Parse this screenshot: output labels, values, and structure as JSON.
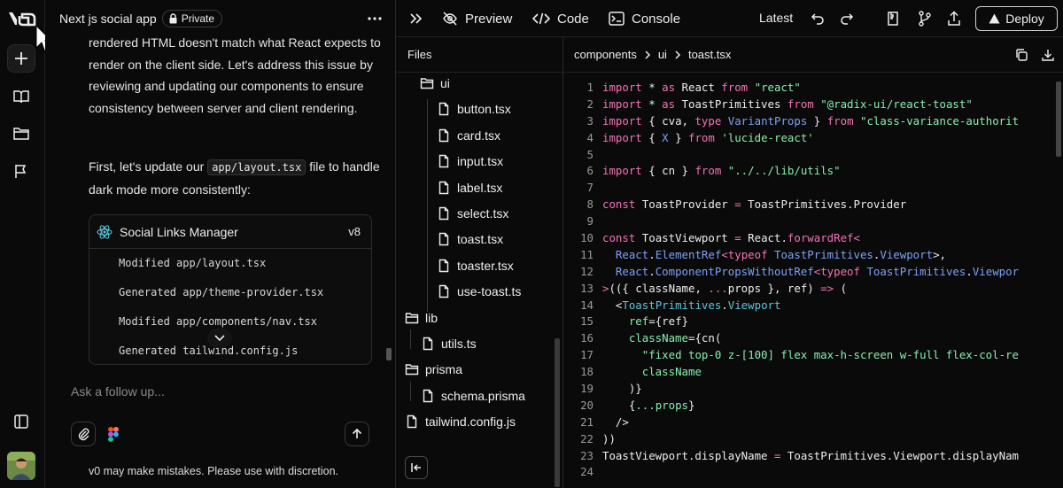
{
  "chat": {
    "title": "Next js social app",
    "badge": "Private",
    "message_part1": "rendered HTML doesn't match what React expects to render on the client side. Let's address this issue by reviewing and updating our components to ensure consistency between server and client rendering.",
    "message_part2_before": "First, let's update our ",
    "message_part2_code": "app/layout.tsx",
    "message_part2_after": " file to handle dark mode more consistently:",
    "card": {
      "title": "Social Links Manager",
      "version": "v8",
      "lines": [
        "Modified app/layout.tsx",
        "Generated app/theme-provider.tsx",
        "Modified app/components/nav.tsx",
        "Generated tailwind.config.js"
      ]
    },
    "input_placeholder": "Ask a follow up...",
    "disclaimer": "v0 may make mistakes. Please use with discretion."
  },
  "topbar": {
    "preview": "Preview",
    "code": "Code",
    "console": "Console",
    "version_label": "Latest",
    "deploy": "Deploy"
  },
  "files": {
    "header": "Files",
    "tree": [
      {
        "label": "ui",
        "kind": "folder"
      },
      {
        "label": "button.tsx",
        "kind": "file"
      },
      {
        "label": "card.tsx",
        "kind": "file"
      },
      {
        "label": "input.tsx",
        "kind": "file"
      },
      {
        "label": "label.tsx",
        "kind": "file"
      },
      {
        "label": "select.tsx",
        "kind": "file"
      },
      {
        "label": "toast.tsx",
        "kind": "file"
      },
      {
        "label": "toaster.tsx",
        "kind": "file"
      },
      {
        "label": "use-toast.ts",
        "kind": "file"
      },
      {
        "label": "lib",
        "kind": "folder"
      },
      {
        "label": "utils.ts",
        "kind": "file"
      },
      {
        "label": "prisma",
        "kind": "folder"
      },
      {
        "label": "schema.prisma",
        "kind": "file"
      },
      {
        "label": "tailwind.config.js",
        "kind": "file"
      }
    ]
  },
  "editor": {
    "breadcrumb": [
      "components",
      "ui",
      "toast.tsx"
    ],
    "lines": [
      [
        [
          "kw",
          "import"
        ],
        [
          "pl",
          " * "
        ],
        [
          "kw",
          "as"
        ],
        [
          "pl",
          " React "
        ],
        [
          "kw",
          "from"
        ],
        [
          "pl",
          " "
        ],
        [
          "str",
          "\"react\""
        ]
      ],
      [
        [
          "kw",
          "import"
        ],
        [
          "pl",
          " * "
        ],
        [
          "kw",
          "as"
        ],
        [
          "pl",
          " ToastPrimitives "
        ],
        [
          "kw",
          "from"
        ],
        [
          "pl",
          " "
        ],
        [
          "str",
          "\"@radix-ui/react-toast\""
        ]
      ],
      [
        [
          "kw",
          "import"
        ],
        [
          "pl",
          " { cva, "
        ],
        [
          "kw",
          "type"
        ],
        [
          "pl",
          " "
        ],
        [
          "ty",
          "VariantProps"
        ],
        [
          "pl",
          " } "
        ],
        [
          "kw",
          "from"
        ],
        [
          "pl",
          " "
        ],
        [
          "str",
          "\"class-variance-authorit"
        ]
      ],
      [
        [
          "kw",
          "import"
        ],
        [
          "pl",
          " { "
        ],
        [
          "ty",
          "X"
        ],
        [
          "pl",
          " } "
        ],
        [
          "kw",
          "from"
        ],
        [
          "pl",
          " "
        ],
        [
          "str",
          "'lucide-react'"
        ]
      ],
      [],
      [
        [
          "kw",
          "import"
        ],
        [
          "pl",
          " { cn } "
        ],
        [
          "kw",
          "from"
        ],
        [
          "pl",
          " "
        ],
        [
          "str",
          "\"../../lib/utils\""
        ]
      ],
      [],
      [
        [
          "kw",
          "const"
        ],
        [
          "pl",
          " ToastProvider "
        ],
        [
          "kw",
          "="
        ],
        [
          "pl",
          " ToastPrimitives.Provider"
        ]
      ],
      [],
      [
        [
          "kw",
          "const"
        ],
        [
          "pl",
          " ToastViewport "
        ],
        [
          "kw",
          "="
        ],
        [
          "pl",
          " React."
        ],
        [
          "kw",
          "forwardRef"
        ],
        [
          "kw",
          "<"
        ]
      ],
      [
        [
          "pl",
          "  "
        ],
        [
          "ty",
          "React"
        ],
        [
          "pl",
          "."
        ],
        [
          "ty",
          "ElementRef"
        ],
        [
          "kw",
          "<typeof"
        ],
        [
          "pl",
          " "
        ],
        [
          "ty",
          "ToastPrimitives"
        ],
        [
          "pl",
          "."
        ],
        [
          "ty",
          "Viewport"
        ],
        [
          "pl",
          ">,"
        ]
      ],
      [
        [
          "pl",
          "  "
        ],
        [
          "ty",
          "React"
        ],
        [
          "pl",
          "."
        ],
        [
          "ty",
          "ComponentPropsWithoutRef"
        ],
        [
          "kw",
          "<typeof"
        ],
        [
          "pl",
          " "
        ],
        [
          "ty",
          "ToastPrimitives"
        ],
        [
          "pl",
          "."
        ],
        [
          "ty",
          "Viewpor"
        ]
      ],
      [
        [
          "kw",
          ">"
        ],
        [
          "pl",
          "(({ className, "
        ],
        [
          "kw",
          "..."
        ],
        [
          "pl",
          "props }, ref) "
        ],
        [
          "kw",
          "=>"
        ],
        [
          "pl",
          " ("
        ]
      ],
      [
        [
          "pl",
          "  <"
        ],
        [
          "tg",
          "ToastPrimitives"
        ],
        [
          "pl",
          "."
        ],
        [
          "tg",
          "Viewport"
        ]
      ],
      [
        [
          "pl",
          "    "
        ],
        [
          "at",
          "ref"
        ],
        [
          "pl",
          "={"
        ],
        [
          "pl",
          "ref"
        ],
        [
          "pl",
          "}"
        ]
      ],
      [
        [
          "pl",
          "    "
        ],
        [
          "at",
          "className"
        ],
        [
          "pl",
          "={"
        ],
        [
          "pl",
          "cn("
        ]
      ],
      [
        [
          "pl",
          "      "
        ],
        [
          "str",
          "\"fixed top-0 z-[100] flex max-h-screen w-full flex-col-re"
        ]
      ],
      [
        [
          "pl",
          "      "
        ],
        [
          "at",
          "className"
        ]
      ],
      [
        [
          "pl",
          "    )}"
        ]
      ],
      [
        [
          "pl",
          "    {"
        ],
        [
          "at",
          "...props"
        ],
        [
          "pl",
          "}"
        ]
      ],
      [
        [
          "pl",
          "  />"
        ]
      ],
      [
        [
          "pl",
          "))"
        ]
      ],
      [
        [
          "pl",
          "ToastViewport.displayName "
        ],
        [
          "kw",
          "="
        ],
        [
          "pl",
          " ToastPrimitives.Viewport.displayNam"
        ]
      ],
      []
    ]
  },
  "colors": {
    "background": "#0a0a0a",
    "keyword": "#f472b6",
    "string": "#86efac",
    "type": "#7aa2f7",
    "tag": "#5ec4d8"
  }
}
